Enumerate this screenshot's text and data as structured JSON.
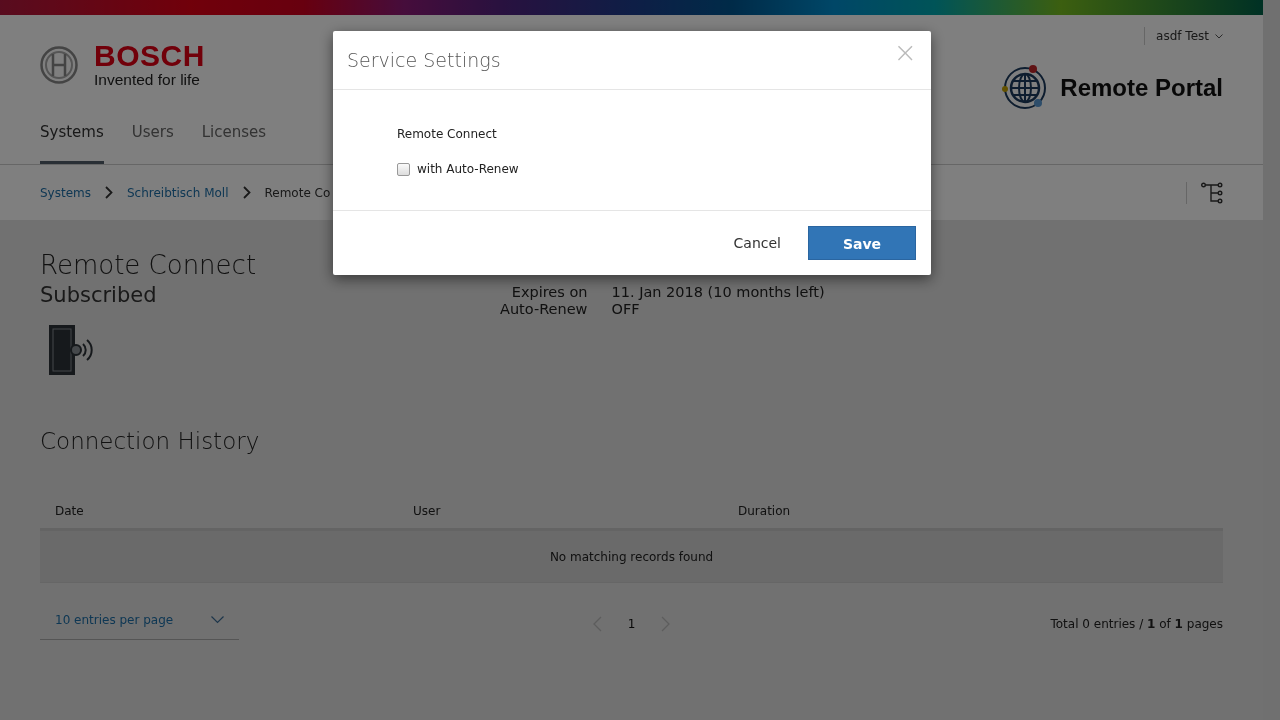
{
  "header": {
    "brand": "BOSCH",
    "tagline": "Invented for life",
    "user_menu": "asdf Test",
    "portal_name": "Remote Portal"
  },
  "tabs": [
    {
      "label": "Systems",
      "selected": true
    },
    {
      "label": "Users",
      "selected": false
    },
    {
      "label": "Licenses",
      "selected": false
    }
  ],
  "breadcrumb": [
    {
      "label": "Systems",
      "link": true
    },
    {
      "label": "Schreibtisch Moll",
      "link": true
    },
    {
      "label": "Remote Co",
      "link": false
    }
  ],
  "service": {
    "title": "Remote Connect",
    "status": "Subscribed",
    "details": [
      {
        "label": "Expires on",
        "value": "11. Jan 2018 (10 months left)"
      },
      {
        "label": "Auto-Renew",
        "value": "OFF"
      }
    ]
  },
  "history": {
    "title": "Connection History",
    "columns": [
      "Date",
      "User",
      "Duration"
    ],
    "empty_message": "No matching records found"
  },
  "pagination": {
    "page_size": "10 entries per page",
    "pages": [
      {
        "label": "1",
        "selected": true
      }
    ],
    "summary": "Total 0 entries / **1** of **1** pages"
  },
  "dialog": {
    "title": "Service Settings",
    "close": "×",
    "section": "Remote Connect",
    "options": [
      {
        "label": "with Auto-Renew",
        "checked": false
      }
    ],
    "buttons": [
      {
        "label": "Cancel",
        "kind": "secondary"
      },
      {
        "label": "Save",
        "kind": "primary"
      }
    ]
  }
}
